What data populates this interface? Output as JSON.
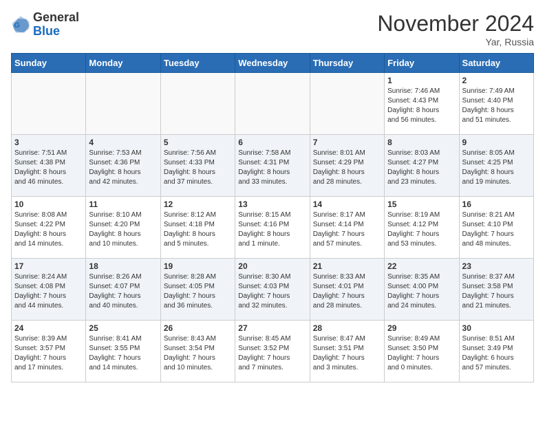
{
  "header": {
    "logo_general": "General",
    "logo_blue": "Blue",
    "month_title": "November 2024",
    "location": "Yar, Russia"
  },
  "weekdays": [
    "Sunday",
    "Monday",
    "Tuesday",
    "Wednesday",
    "Thursday",
    "Friday",
    "Saturday"
  ],
  "weeks": [
    [
      {
        "day": "",
        "info": ""
      },
      {
        "day": "",
        "info": ""
      },
      {
        "day": "",
        "info": ""
      },
      {
        "day": "",
        "info": ""
      },
      {
        "day": "",
        "info": ""
      },
      {
        "day": "1",
        "info": "Sunrise: 7:46 AM\nSunset: 4:43 PM\nDaylight: 8 hours\nand 56 minutes."
      },
      {
        "day": "2",
        "info": "Sunrise: 7:49 AM\nSunset: 4:40 PM\nDaylight: 8 hours\nand 51 minutes."
      }
    ],
    [
      {
        "day": "3",
        "info": "Sunrise: 7:51 AM\nSunset: 4:38 PM\nDaylight: 8 hours\nand 46 minutes."
      },
      {
        "day": "4",
        "info": "Sunrise: 7:53 AM\nSunset: 4:36 PM\nDaylight: 8 hours\nand 42 minutes."
      },
      {
        "day": "5",
        "info": "Sunrise: 7:56 AM\nSunset: 4:33 PM\nDaylight: 8 hours\nand 37 minutes."
      },
      {
        "day": "6",
        "info": "Sunrise: 7:58 AM\nSunset: 4:31 PM\nDaylight: 8 hours\nand 33 minutes."
      },
      {
        "day": "7",
        "info": "Sunrise: 8:01 AM\nSunset: 4:29 PM\nDaylight: 8 hours\nand 28 minutes."
      },
      {
        "day": "8",
        "info": "Sunrise: 8:03 AM\nSunset: 4:27 PM\nDaylight: 8 hours\nand 23 minutes."
      },
      {
        "day": "9",
        "info": "Sunrise: 8:05 AM\nSunset: 4:25 PM\nDaylight: 8 hours\nand 19 minutes."
      }
    ],
    [
      {
        "day": "10",
        "info": "Sunrise: 8:08 AM\nSunset: 4:22 PM\nDaylight: 8 hours\nand 14 minutes."
      },
      {
        "day": "11",
        "info": "Sunrise: 8:10 AM\nSunset: 4:20 PM\nDaylight: 8 hours\nand 10 minutes."
      },
      {
        "day": "12",
        "info": "Sunrise: 8:12 AM\nSunset: 4:18 PM\nDaylight: 8 hours\nand 5 minutes."
      },
      {
        "day": "13",
        "info": "Sunrise: 8:15 AM\nSunset: 4:16 PM\nDaylight: 8 hours\nand 1 minute."
      },
      {
        "day": "14",
        "info": "Sunrise: 8:17 AM\nSunset: 4:14 PM\nDaylight: 7 hours\nand 57 minutes."
      },
      {
        "day": "15",
        "info": "Sunrise: 8:19 AM\nSunset: 4:12 PM\nDaylight: 7 hours\nand 53 minutes."
      },
      {
        "day": "16",
        "info": "Sunrise: 8:21 AM\nSunset: 4:10 PM\nDaylight: 7 hours\nand 48 minutes."
      }
    ],
    [
      {
        "day": "17",
        "info": "Sunrise: 8:24 AM\nSunset: 4:08 PM\nDaylight: 7 hours\nand 44 minutes."
      },
      {
        "day": "18",
        "info": "Sunrise: 8:26 AM\nSunset: 4:07 PM\nDaylight: 7 hours\nand 40 minutes."
      },
      {
        "day": "19",
        "info": "Sunrise: 8:28 AM\nSunset: 4:05 PM\nDaylight: 7 hours\nand 36 minutes."
      },
      {
        "day": "20",
        "info": "Sunrise: 8:30 AM\nSunset: 4:03 PM\nDaylight: 7 hours\nand 32 minutes."
      },
      {
        "day": "21",
        "info": "Sunrise: 8:33 AM\nSunset: 4:01 PM\nDaylight: 7 hours\nand 28 minutes."
      },
      {
        "day": "22",
        "info": "Sunrise: 8:35 AM\nSunset: 4:00 PM\nDaylight: 7 hours\nand 24 minutes."
      },
      {
        "day": "23",
        "info": "Sunrise: 8:37 AM\nSunset: 3:58 PM\nDaylight: 7 hours\nand 21 minutes."
      }
    ],
    [
      {
        "day": "24",
        "info": "Sunrise: 8:39 AM\nSunset: 3:57 PM\nDaylight: 7 hours\nand 17 minutes."
      },
      {
        "day": "25",
        "info": "Sunrise: 8:41 AM\nSunset: 3:55 PM\nDaylight: 7 hours\nand 14 minutes."
      },
      {
        "day": "26",
        "info": "Sunrise: 8:43 AM\nSunset: 3:54 PM\nDaylight: 7 hours\nand 10 minutes."
      },
      {
        "day": "27",
        "info": "Sunrise: 8:45 AM\nSunset: 3:52 PM\nDaylight: 7 hours\nand 7 minutes."
      },
      {
        "day": "28",
        "info": "Sunrise: 8:47 AM\nSunset: 3:51 PM\nDaylight: 7 hours\nand 3 minutes."
      },
      {
        "day": "29",
        "info": "Sunrise: 8:49 AM\nSunset: 3:50 PM\nDaylight: 7 hours\nand 0 minutes."
      },
      {
        "day": "30",
        "info": "Sunrise: 8:51 AM\nSunset: 3:49 PM\nDaylight: 6 hours\nand 57 minutes."
      }
    ]
  ]
}
